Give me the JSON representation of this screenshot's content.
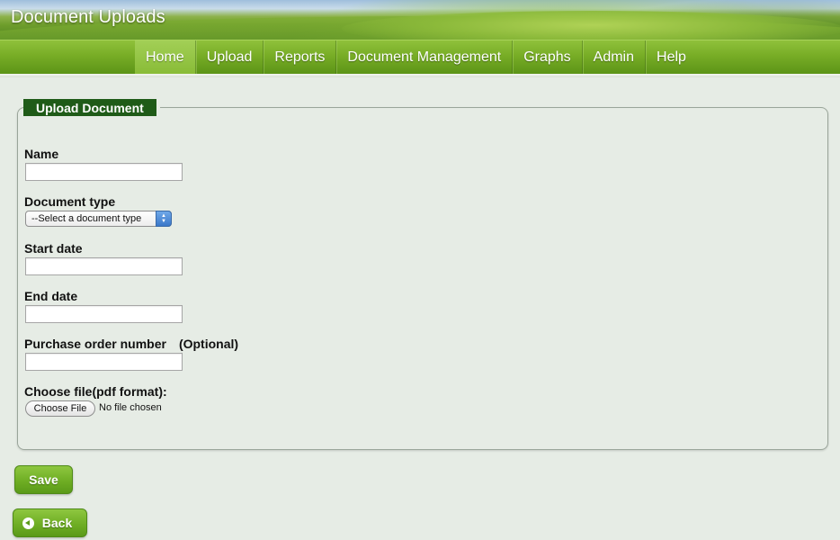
{
  "header": {
    "title": "Document Uploads"
  },
  "nav": {
    "items": [
      {
        "label": "Home",
        "active": true
      },
      {
        "label": "Upload",
        "active": false
      },
      {
        "label": "Reports",
        "active": false
      },
      {
        "label": "Document Management",
        "active": false
      },
      {
        "label": "Graphs",
        "active": false
      },
      {
        "label": "Admin",
        "active": false
      },
      {
        "label": "Help",
        "active": false
      }
    ]
  },
  "form": {
    "legend": "Upload Document",
    "name": {
      "label": "Name",
      "value": ""
    },
    "document_type": {
      "label": "Document type",
      "selected": "--Select a document type"
    },
    "start_date": {
      "label": "Start date",
      "value": ""
    },
    "end_date": {
      "label": "End date",
      "value": ""
    },
    "purchase_order": {
      "label": "Purchase order number",
      "optional_note": "(Optional)",
      "value": ""
    },
    "file": {
      "label": "Choose file(pdf format):",
      "button_label": "Choose File",
      "status": "No file chosen"
    }
  },
  "actions": {
    "save_label": "Save",
    "back_label": "Back"
  },
  "colors": {
    "nav_green": "#78ad26",
    "legend_dark_green": "#1f5b18",
    "page_background": "#e6ece5",
    "button_green": "#6fae24"
  },
  "icons": {
    "back": "back-arrow-icon",
    "select_arrows": "select-arrows-icon"
  }
}
